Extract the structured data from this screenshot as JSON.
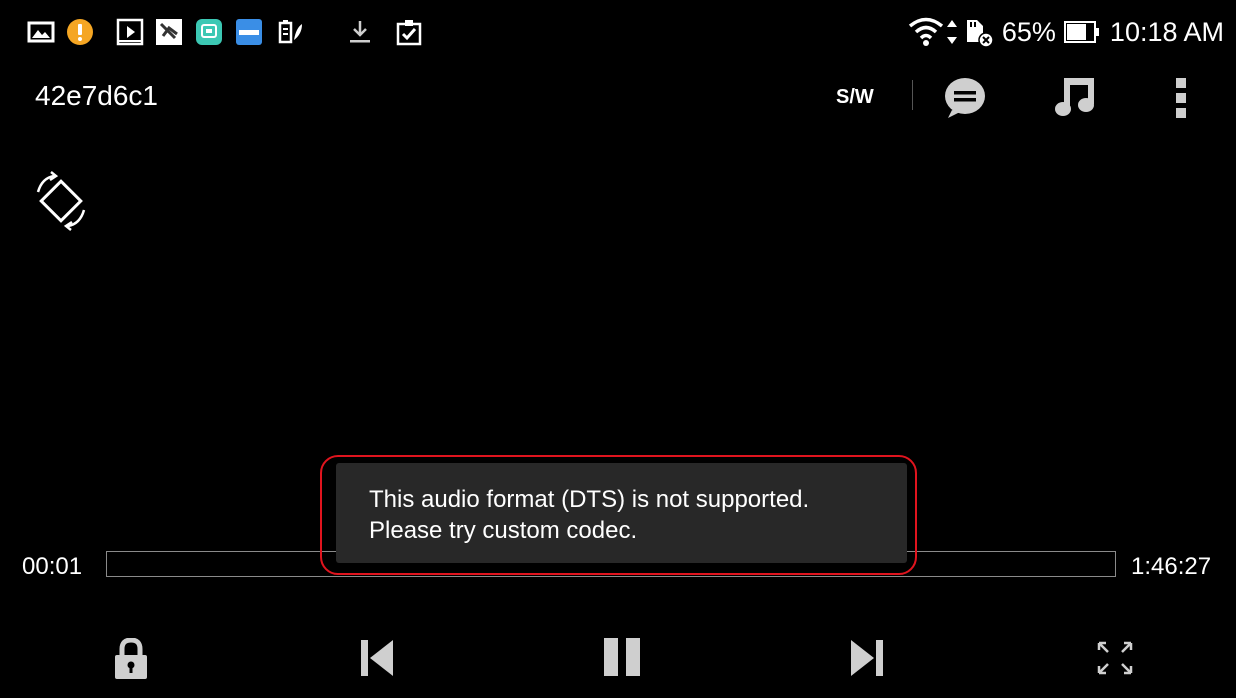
{
  "status_bar": {
    "battery_percent": "65%",
    "time": "10:18 AM",
    "notification_icons": [
      "photo-icon",
      "alert-icon",
      "video-icon",
      "shield-app-icon",
      "chat-app-icon",
      "asus-icon",
      "battery-saver-icon",
      "download-icon",
      "clipboard-check-icon"
    ],
    "right_icons": [
      "wifi-icon",
      "data-arrows-icon",
      "sd-card-icon",
      "battery-icon"
    ]
  },
  "top_bar": {
    "title": "42e7d6c1",
    "sw_label": "S/W"
  },
  "toast": {
    "line1": "This audio format (DTS) is not supported.",
    "line2": "Please try custom codec."
  },
  "seek": {
    "current_time": "00:01",
    "total_time": "1:46:27",
    "progress_fraction": 0.0
  },
  "colors": {
    "background": "#000000",
    "toast_bg": "#282828",
    "highlight": "#e0141e",
    "icon_gray": "#cfcfcf"
  }
}
